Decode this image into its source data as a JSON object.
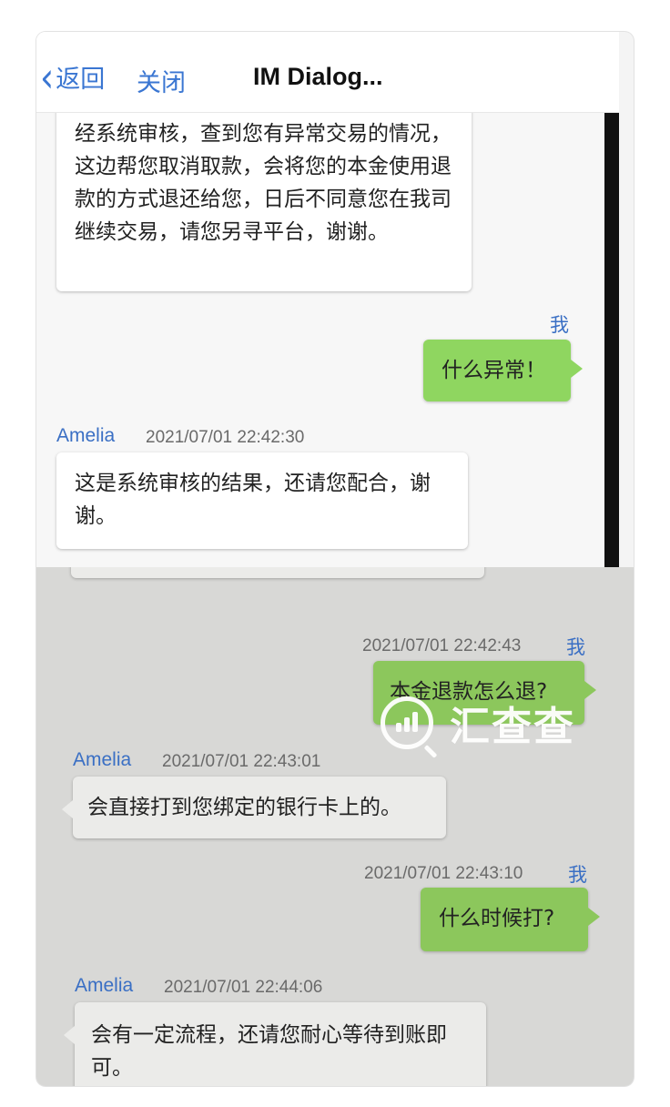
{
  "header": {
    "back_label": "返回",
    "close_label": "关闭",
    "title": "IM Dialog..."
  },
  "messages": [
    {
      "side": "in",
      "sender": "",
      "time": "",
      "text": "经系统审核，查到您有异常交易的情况，这边帮您取消取款，会将您的本金使用退款的方式退还给您，日后不同意您在我司继续交易，请您另寻平台，谢谢。"
    },
    {
      "side": "out",
      "sender": "我",
      "time": "",
      "text": "什么异常！"
    },
    {
      "side": "in",
      "sender": "Amelia",
      "time": "2021/07/01 22:42:30",
      "text": "这是系统审核的结果，还请您配合，谢谢。"
    },
    {
      "side": "out",
      "sender": "我",
      "time": "2021/07/01 22:42:43",
      "text": "本金退款怎么退?"
    },
    {
      "side": "in",
      "sender": "Amelia",
      "time": "2021/07/01 22:43:01",
      "text": "会直接打到您绑定的银行卡上的。"
    },
    {
      "side": "out",
      "sender": "我",
      "time": "2021/07/01 22:43:10",
      "text": "什么时候打?"
    },
    {
      "side": "in",
      "sender": "Amelia",
      "time": "2021/07/01 22:44:06",
      "text": "会有一定流程，还请您耐心等待到账即可。"
    }
  ],
  "watermark": {
    "text": "汇查查",
    "icon": "chart-magnifier-icon"
  },
  "colors": {
    "link": "#3a76d2",
    "outgoing_bubble": "#8fd660",
    "incoming_bubble": "#ffffff"
  }
}
